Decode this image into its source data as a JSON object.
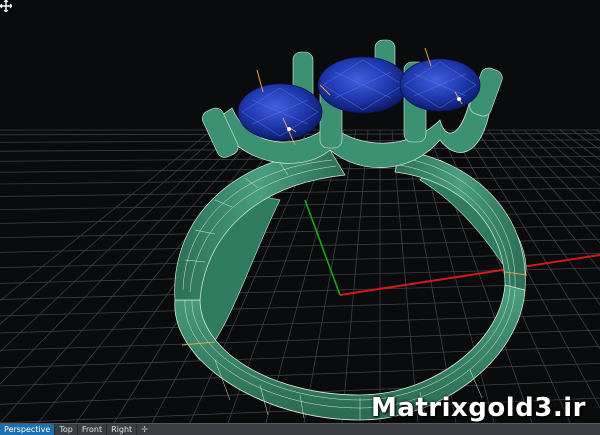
{
  "viewport": {
    "watermark": "Matrixgold3.ir",
    "colors": {
      "background": "#090b0d",
      "grid": "#3b3f45",
      "axis_x": "#d11a1a",
      "axis_y": "#18a818",
      "metal": "#3d9173",
      "metal_shade": "#23604a",
      "wire": "#d8ead8",
      "gem": "#1f38ad",
      "prong_marker": "#e8a14a"
    }
  },
  "tabs": {
    "items": [
      {
        "label": "Perspective"
      },
      {
        "label": "Top"
      },
      {
        "label": "Front"
      },
      {
        "label": "Right"
      }
    ],
    "active_index": 0,
    "add_icon": "plus-icon"
  }
}
